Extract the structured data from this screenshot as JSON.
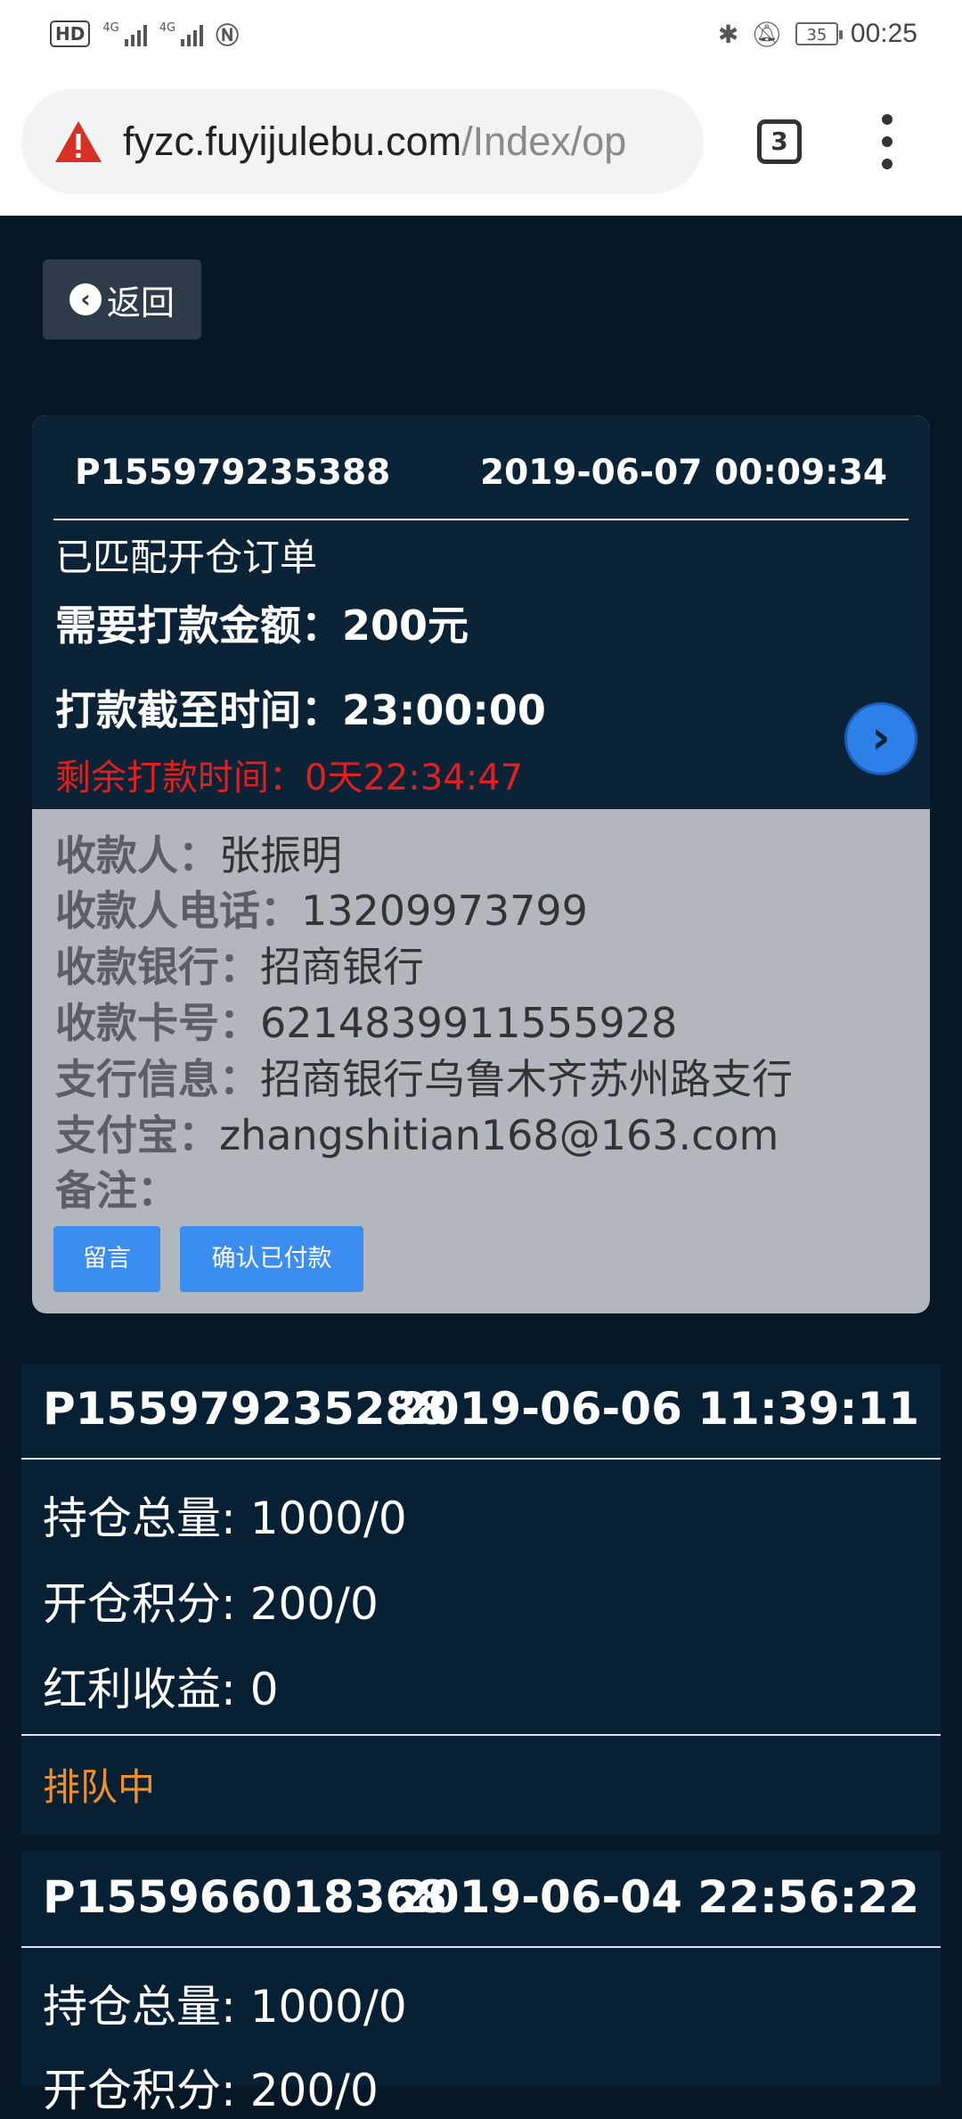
{
  "status_bar": {
    "hd": "HD",
    "signal1": "4G",
    "signal2": "4G",
    "battery": "35",
    "time": "00:25"
  },
  "browser": {
    "url_host": "fyzc.fuyijulebu.com",
    "url_path": "/Index/op",
    "tab_count": "3"
  },
  "back_label": "返回",
  "matched_order": {
    "id": "P155979235388",
    "datetime": "2019-06-07 00:09:34",
    "status": "已匹配开仓订单",
    "amount_label": "需要打款金额：",
    "amount_value": "200元",
    "deadline_label": "打款截至时间：",
    "deadline_value": "23:00:00",
    "remaining_label": "剩余打款时间：",
    "remaining_value": "0天22:34:47",
    "payee": [
      {
        "label": "收款人：",
        "value": "张振明"
      },
      {
        "label": "收款人电话：",
        "value": "13209973799"
      },
      {
        "label": "收款银行：",
        "value": "招商银行"
      },
      {
        "label": "收款卡号：",
        "value": "6214839911555928"
      },
      {
        "label": "支行信息：",
        "value": "招商银行乌鲁木齐苏州路支行"
      },
      {
        "label": "支付宝：",
        "value": "zhangshitian168@163.com"
      },
      {
        "label": "备注：",
        "value": ""
      }
    ],
    "message_button": "留言",
    "confirm_button": "确认已付款"
  },
  "orders": [
    {
      "id": "P155979235288",
      "datetime": "2019-06-06 11:39:11",
      "holding": "持仓总量: 1000/0",
      "points": "开仓积分: 200/0",
      "dividend": "红利收益: 0",
      "status": "排队中"
    },
    {
      "id": "P155966018368",
      "datetime": "2019-06-04 22:56:22",
      "holding": "持仓总量: 1000/0",
      "points": "开仓积分: 200/0"
    }
  ],
  "colors": {
    "page_bg": "#061826",
    "card_bg": "#0b2337",
    "detail_bg": "#b2b7bd",
    "accent_blue": "#3b8ef0",
    "remaining_red": "#e01f1f",
    "queue_orange": "#f0902a"
  }
}
